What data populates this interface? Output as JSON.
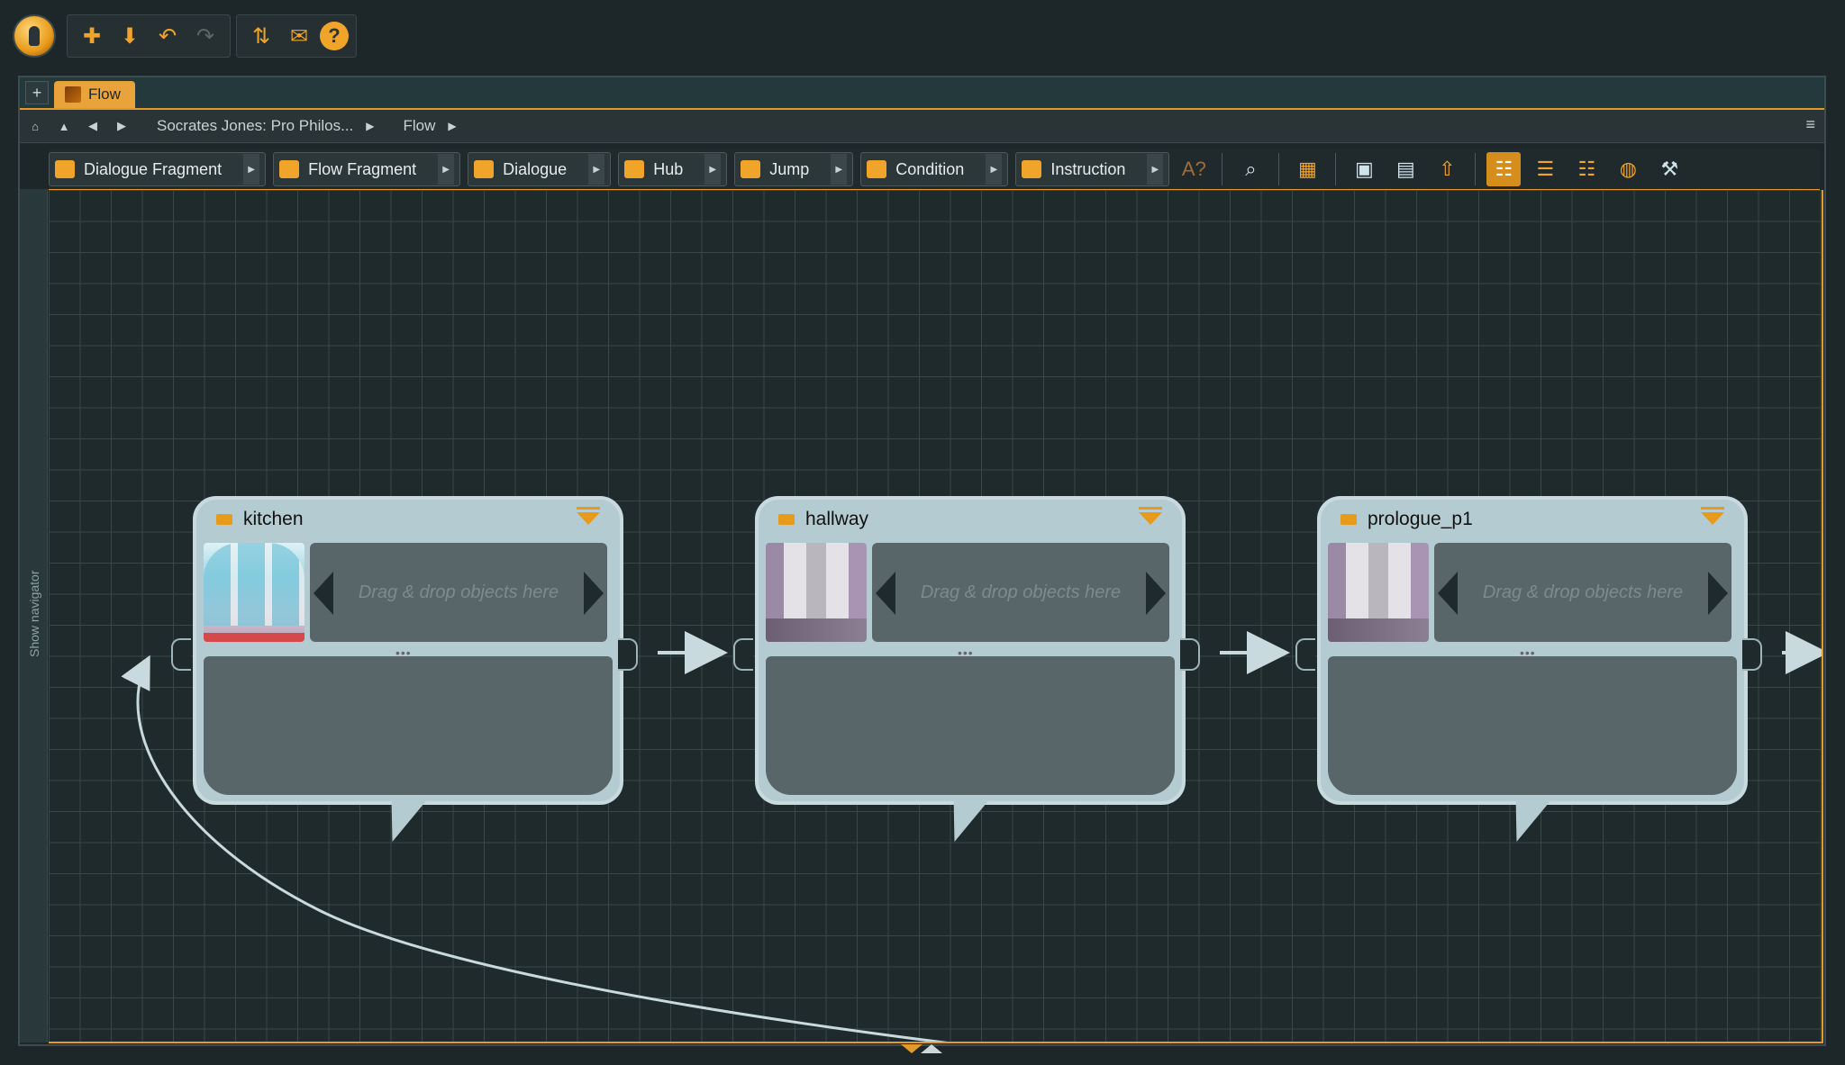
{
  "window": {
    "tab_label": "Flow",
    "tab_add": "+"
  },
  "breadcrumb": {
    "project": "Socrates Jones: Pro Philos...",
    "current": "Flow"
  },
  "toolbar": {
    "create_buttons": [
      "Dialogue Fragment",
      "Flow Fragment",
      "Dialogue",
      "Hub",
      "Jump",
      "Condition",
      "Instruction"
    ]
  },
  "navigator": {
    "label": "Show navigator"
  },
  "nodes": [
    {
      "title": "kitchen",
      "drop_hint": "Drag & drop objects here"
    },
    {
      "title": "hallway",
      "drop_hint": "Drag & drop objects here"
    },
    {
      "title": "prologue_p1",
      "drop_hint": "Drag & drop objects here"
    }
  ],
  "colors": {
    "accent": "#e29a2b",
    "canvas": "#1f2a2c",
    "node": "#b4ccd1",
    "node_inner": "#58666a"
  },
  "icons": [
    "articy-logo-icon",
    "new-icon",
    "save-icon",
    "undo-icon",
    "redo-icon",
    "merge-icon",
    "mail-icon",
    "help-icon",
    "home-icon",
    "rss-icon",
    "zoom-icon",
    "grid-icon",
    "layout-icon"
  ]
}
